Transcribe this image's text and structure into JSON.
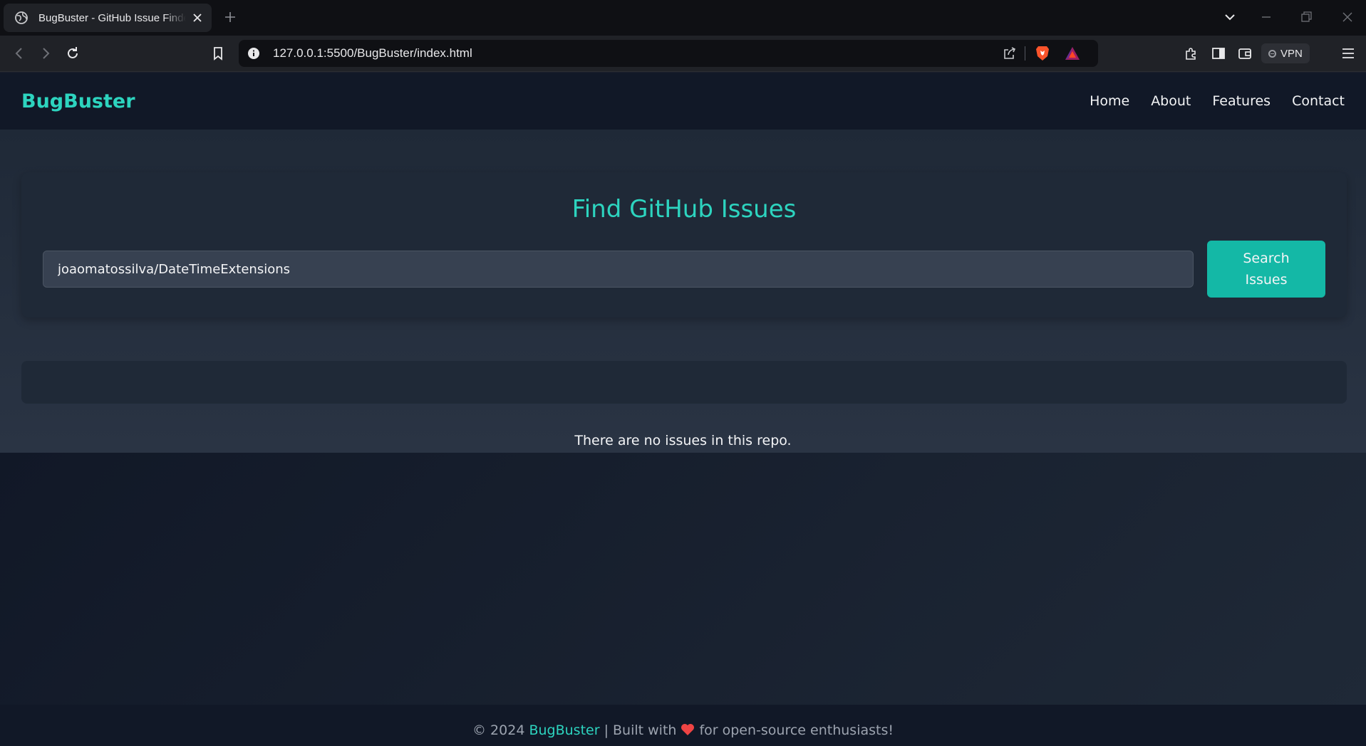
{
  "browser": {
    "tab_title": "BugBuster - GitHub Issue Finder",
    "url": "127.0.0.1:5500/BugBuster/index.html",
    "vpn_label": "VPN"
  },
  "navbar": {
    "brand": "BugBuster",
    "links": [
      "Home",
      "About",
      "Features",
      "Contact"
    ]
  },
  "search": {
    "title": "Find GitHub Issues",
    "input_value": "joaomatossilva/DateTimeExtensions",
    "button_label_line1": "Search",
    "button_label_line2": "Issues"
  },
  "results": {
    "empty_message": "There are no issues in this repo."
  },
  "footer": {
    "prefix": "© 2024 ",
    "brand": "BugBuster",
    "built_with": " | Built with",
    "suffix": "for open-source enthusiasts!"
  },
  "colors": {
    "accent": "#2dd4bf",
    "button": "#14b8a6",
    "heart": "#ef4444"
  }
}
